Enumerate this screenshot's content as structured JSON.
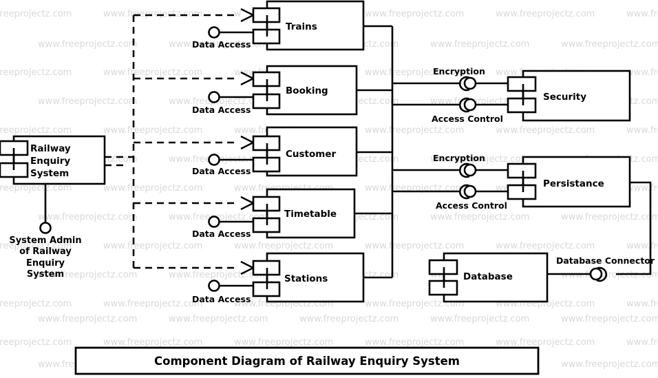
{
  "diagram": {
    "caption": "Component Diagram of Railway Enquiry System",
    "type": "UML Component Diagram"
  },
  "system": {
    "name": "Railway\nEnquiry\nSystem",
    "name_line1": "Railway",
    "name_line2": "Enquiry",
    "name_line3": "System"
  },
  "actor": {
    "label": "System Admin of Railway Enquiry System",
    "line1": "System Admin",
    "line2": "of Railway",
    "line3": "Enquiry",
    "line4": "System"
  },
  "components": [
    {
      "name": "Trains",
      "interface": "Data Access"
    },
    {
      "name": "Booking",
      "interface": "Data Access"
    },
    {
      "name": "Customer",
      "interface": "Data Access"
    },
    {
      "name": "Timetable",
      "interface": "Data Access"
    },
    {
      "name": "Stations",
      "interface": "Data Access"
    }
  ],
  "services": [
    {
      "name": "Security",
      "interfaces": [
        "Encryption",
        "Access Control"
      ]
    },
    {
      "name": "Persistance",
      "interfaces": [
        "Encryption",
        "Access Control"
      ]
    }
  ],
  "storage": {
    "name": "Database",
    "connector": "Database Connector"
  },
  "interfaces": {
    "data_access": "Data Access",
    "encryption": "Encryption",
    "access_control": "Access Control",
    "database_connector": "Database Connector"
  },
  "watermark": {
    "text": "www.freeprojectz.com",
    "short_text": "www.freepro",
    "color": "#d8d8d8"
  },
  "colors": {
    "stroke": "#000000",
    "background": "#ffffff",
    "watermark": "#d8d8d8"
  }
}
